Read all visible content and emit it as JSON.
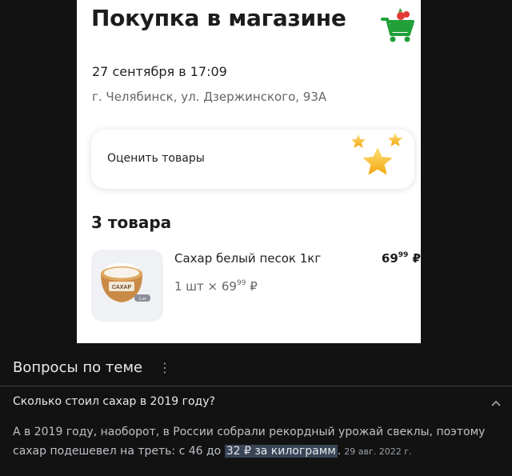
{
  "receipt": {
    "title": "Покупка в магазине",
    "date": "27 сентября в 17:09",
    "address": "г. Челябинск, ул. Дзержинского, 93А",
    "rate_label": "Оценить товары",
    "items_heading": "3 товара",
    "item": {
      "name": "Сахар белый песок 1кг",
      "qty_prefix": "1 шт × 69",
      "qty_kop": "99",
      "qty_currency": " ₽",
      "price_rub": "69",
      "price_kop": "99",
      "price_currency": " ₽",
      "thumb_label": "САХАР",
      "thumb_weight": "1 кг"
    },
    "icons": {
      "cart": "shopping-cart-icon",
      "stars": "stars-icon"
    },
    "colors": {
      "cart_green": "#21a038",
      "star_gold": "#f6b81c"
    }
  },
  "related": {
    "heading": "Вопросы по теме",
    "question": "Сколько стоил сахар в 2019 году?",
    "answer_before": "А в 2019 году, наоборот, в России собрали рекордный урожай свеклы, поэтому сахар подешевел на треть: с 46 до ",
    "answer_highlight": "32 ₽ за килограмм",
    "answer_after": ".",
    "answer_date": "29 авг. 2022 г.",
    "colors": {
      "background": "#121212",
      "text": "#e8eaed",
      "highlight": "#394457"
    }
  }
}
